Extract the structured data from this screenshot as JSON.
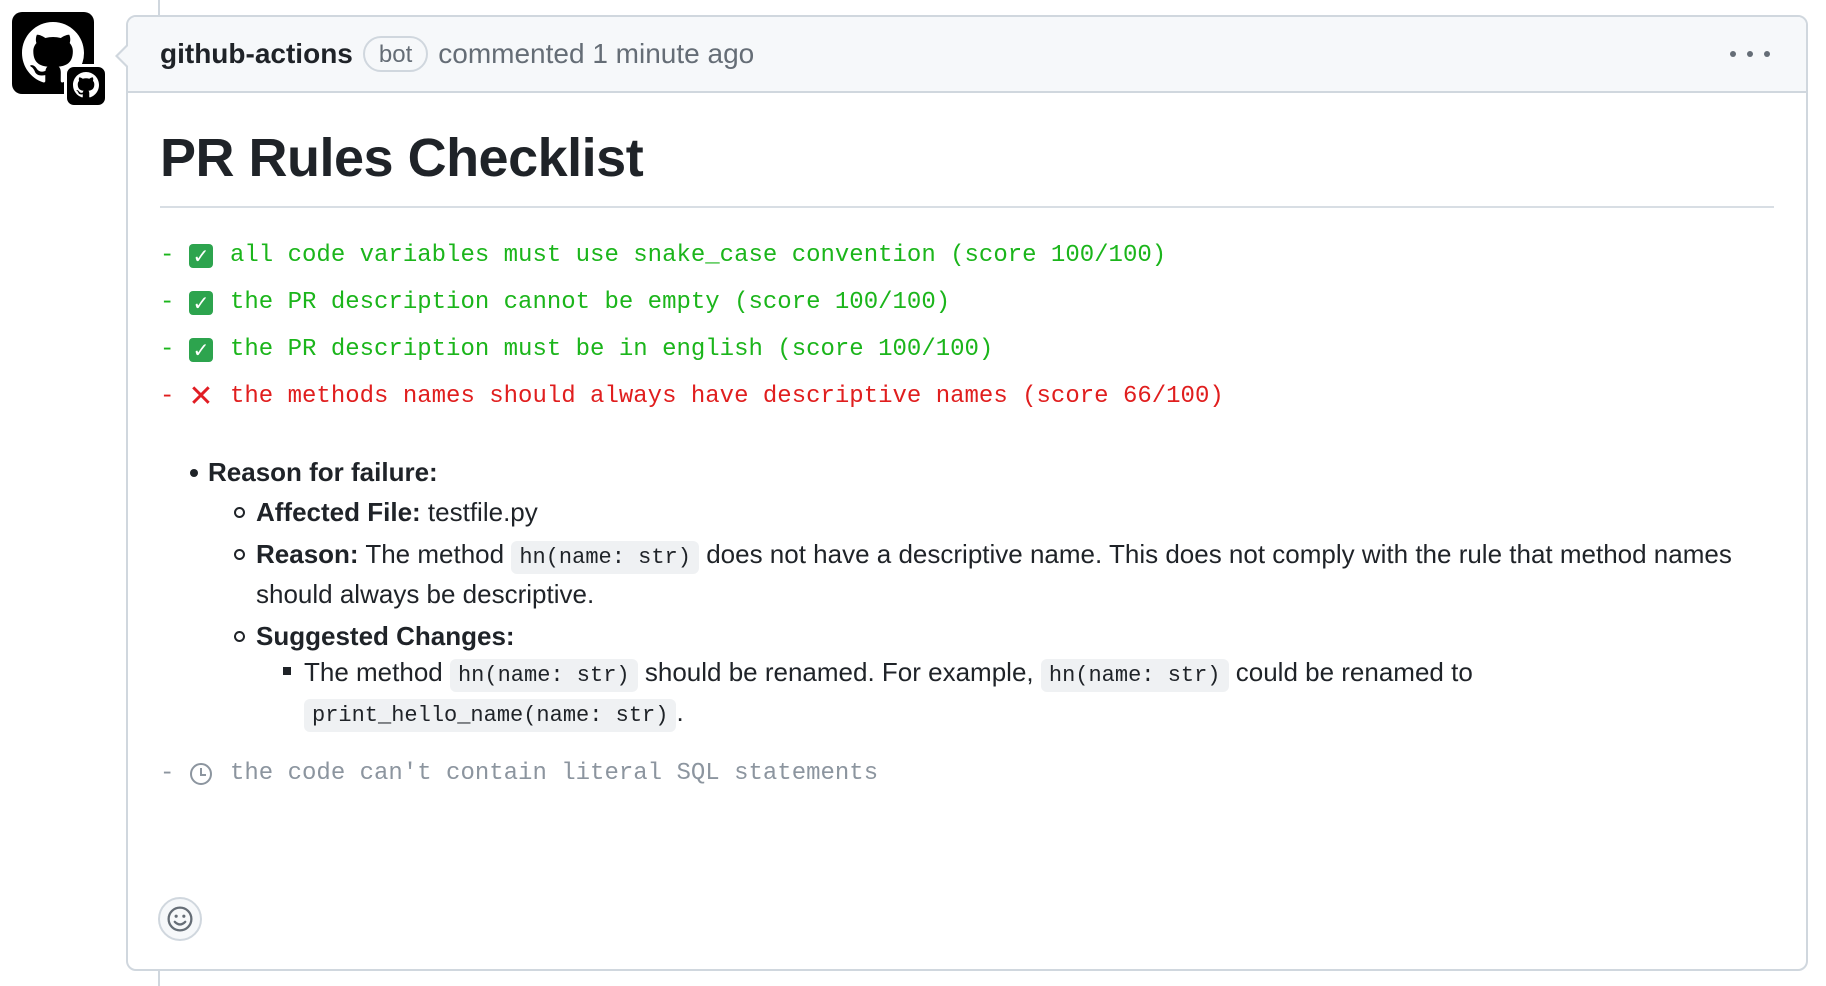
{
  "comment": {
    "author": "github-actions",
    "badge": "bot",
    "meta": "commented 1 minute ago",
    "more_label": "More options"
  },
  "title": "PR Rules Checklist",
  "rules": [
    {
      "dash": "-",
      "status": "pass",
      "icon": "check-icon",
      "text": "all code variables must use snake_case convention (score 100/100)"
    },
    {
      "dash": "-",
      "status": "pass",
      "icon": "check-icon",
      "text": "the PR description cannot be empty (score 100/100)"
    },
    {
      "dash": "-",
      "status": "pass",
      "icon": "check-icon",
      "text": "the PR description must be in english (score 100/100)"
    },
    {
      "dash": "-",
      "status": "fail",
      "icon": "cross-icon",
      "text": "the methods names should always have descriptive names (score 66/100)"
    }
  ],
  "failure": {
    "heading": "Reason for failure:",
    "affected_label": "Affected File:",
    "affected_value": "testfile.py",
    "reason_label": "Reason:",
    "reason_text_1": "The method",
    "reason_code": "hn(name: str)",
    "reason_text_2": "does not have a descriptive name. This does not comply with the rule that method names should always be descriptive.",
    "suggested_label": "Suggested Changes:",
    "suggestion_text_1": "The method",
    "suggestion_code_1": "hn(name: str)",
    "suggestion_text_2": "should be renamed. For example,",
    "suggestion_code_2": "hn(name: str)",
    "suggestion_text_3": "could be renamed to",
    "suggestion_code_3": "print_hello_name(name: str)",
    "suggestion_text_4": "."
  },
  "pending_rule": {
    "dash": "-",
    "status": "pending",
    "icon": "clock-icon",
    "text": "the code can't contain literal SQL statements"
  },
  "colors": {
    "pass": "#1bb51b",
    "fail": "#e01e1e",
    "pending": "#8c959f"
  }
}
